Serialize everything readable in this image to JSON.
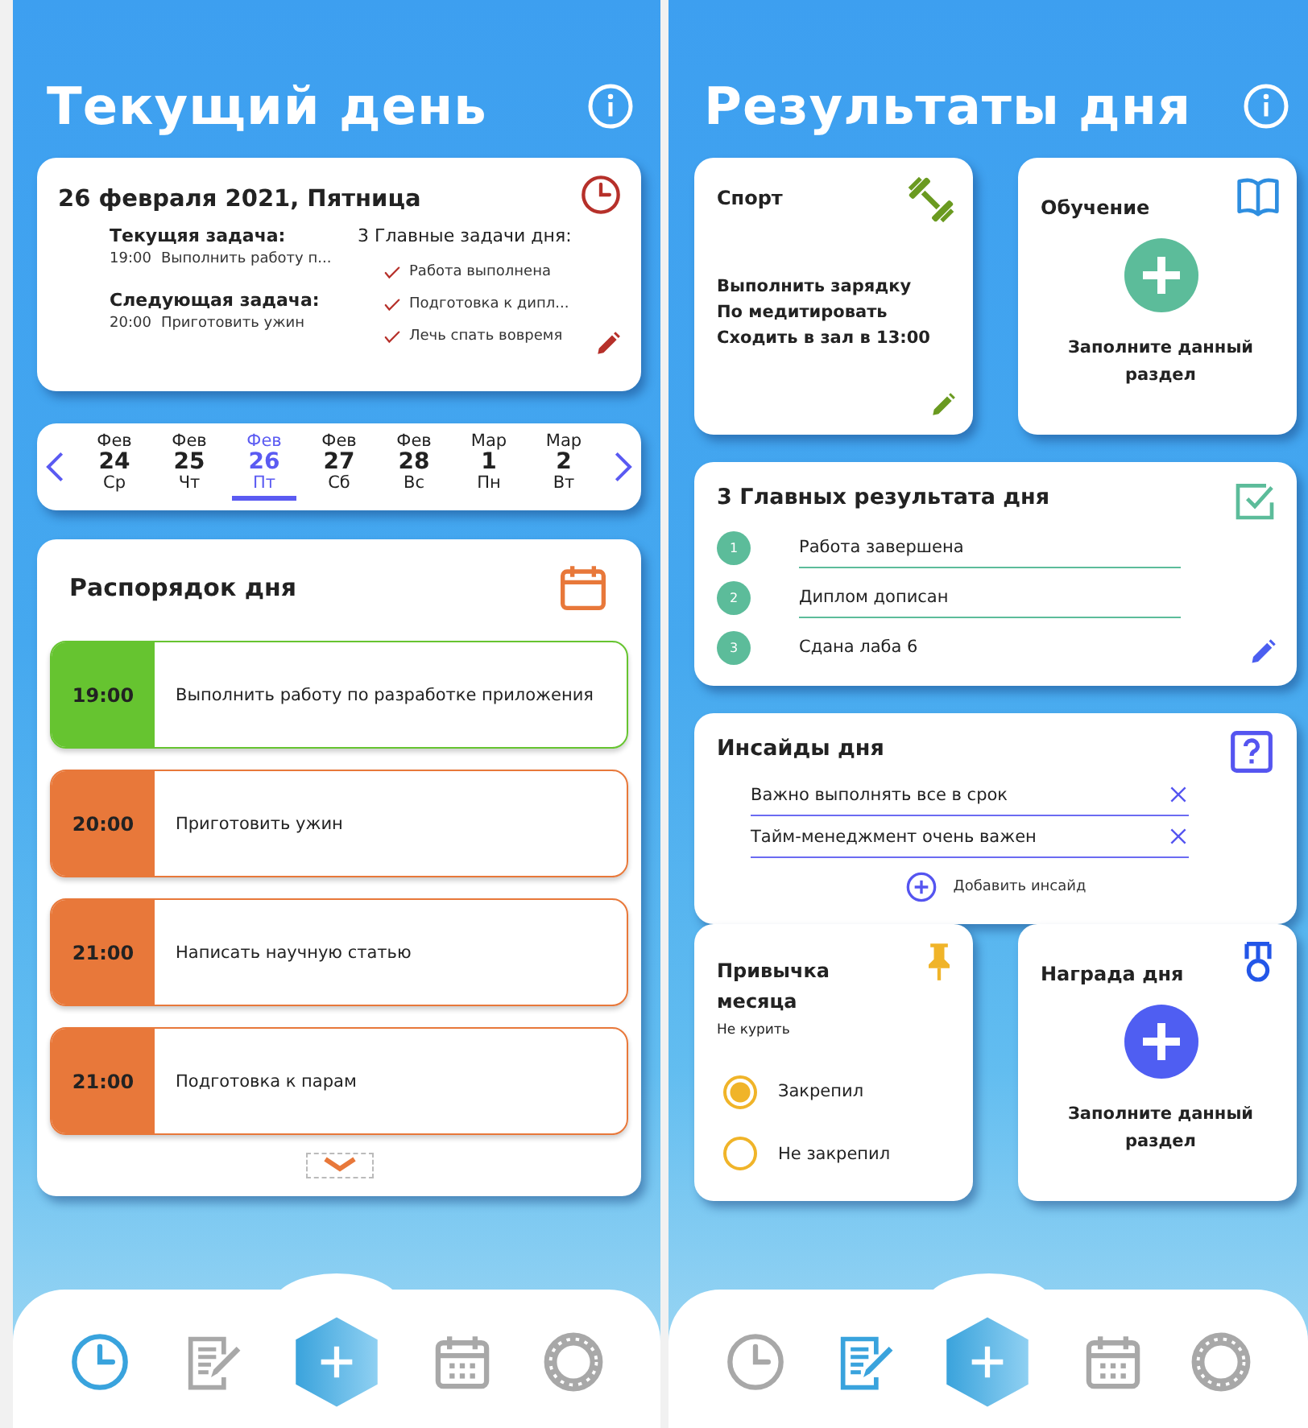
{
  "current_day": {
    "title": "Текущий день",
    "summary": {
      "date": "26 февраля 2021, Пятница",
      "current_task": {
        "label": "Текущяя задача:",
        "time": "19:00",
        "text": "Выполнить работу п..."
      },
      "next_task": {
        "label": "Следующая задача:",
        "time": "20:00",
        "text": "Приготовить ужин"
      },
      "top_tasks_title": "3 Главные задачи дня:",
      "top_tasks": [
        {
          "text": "Работа выполнена",
          "checked": true
        },
        {
          "text": "Подготовка к дипл...",
          "checked": true
        },
        {
          "text": "Лечь спать вовремя",
          "checked": true
        }
      ]
    },
    "date_strip": {
      "days": [
        {
          "month": "Фев",
          "day": "24",
          "weekday": "Ср",
          "selected": false
        },
        {
          "month": "Фев",
          "day": "25",
          "weekday": "Чт",
          "selected": false
        },
        {
          "month": "Фев",
          "day": "26",
          "weekday": "Пт",
          "selected": true
        },
        {
          "month": "Фев",
          "day": "27",
          "weekday": "Сб",
          "selected": false
        },
        {
          "month": "Фев",
          "day": "28",
          "weekday": "Вс",
          "selected": false
        },
        {
          "month": "Мар",
          "day": "1",
          "weekday": "Пн",
          "selected": false
        },
        {
          "month": "Мар",
          "day": "2",
          "weekday": "Вт",
          "selected": false
        }
      ]
    },
    "schedule": {
      "title": "Распорядок дня",
      "items": [
        {
          "time": "19:00",
          "text": "Выполнить работу по разработке приложения",
          "color": "#66c430"
        },
        {
          "time": "20:00",
          "text": "Приготовить ужин",
          "color": "#e8783a"
        },
        {
          "time": "21:00",
          "text": "Написать научную статью",
          "color": "#e8783a"
        },
        {
          "time": "21:00",
          "text": "Подготовка к парам",
          "color": "#e8783a"
        }
      ]
    },
    "nav": [
      {
        "kind": "clock",
        "selected": true
      },
      {
        "kind": "notes",
        "selected": false
      },
      {
        "kind": "add"
      },
      {
        "kind": "calendar",
        "selected": false
      },
      {
        "kind": "settings",
        "selected": false
      }
    ]
  },
  "day_results": {
    "title": "Результаты дня",
    "sport": {
      "title": "Спорт",
      "lines": [
        "Выполнить зарядку",
        "По медитировать",
        "Сходить в зал в 13:00"
      ]
    },
    "learning": {
      "title": "Обучение",
      "prompt": "Заполните данный раздел"
    },
    "top_results": {
      "title": "3 Главных результата дня",
      "items": [
        {
          "number": "1",
          "text": "Работа завершена"
        },
        {
          "number": "2",
          "text": "Диплом дописан"
        },
        {
          "number": "3",
          "text": "Сдана лаба 6"
        }
      ]
    },
    "insights": {
      "title": "Инсайды дня",
      "items": [
        "Важно выполнять все в срок",
        "Тайм-менеджмент очень важен"
      ],
      "add_label": "Добавить инсайд"
    },
    "habit": {
      "title": "Привычка месяца",
      "habit": "Не курить",
      "options": [
        {
          "label": "Закрепил",
          "selected": true
        },
        {
          "label": "Не закрепил",
          "selected": false
        }
      ]
    },
    "award": {
      "title": "Награда дня",
      "prompt": "Заполните данный раздел"
    },
    "nav": [
      {
        "kind": "clock",
        "selected": false
      },
      {
        "kind": "notes",
        "selected": true
      },
      {
        "kind": "add"
      },
      {
        "kind": "calendar",
        "selected": false
      },
      {
        "kind": "settings",
        "selected": false
      }
    ]
  }
}
